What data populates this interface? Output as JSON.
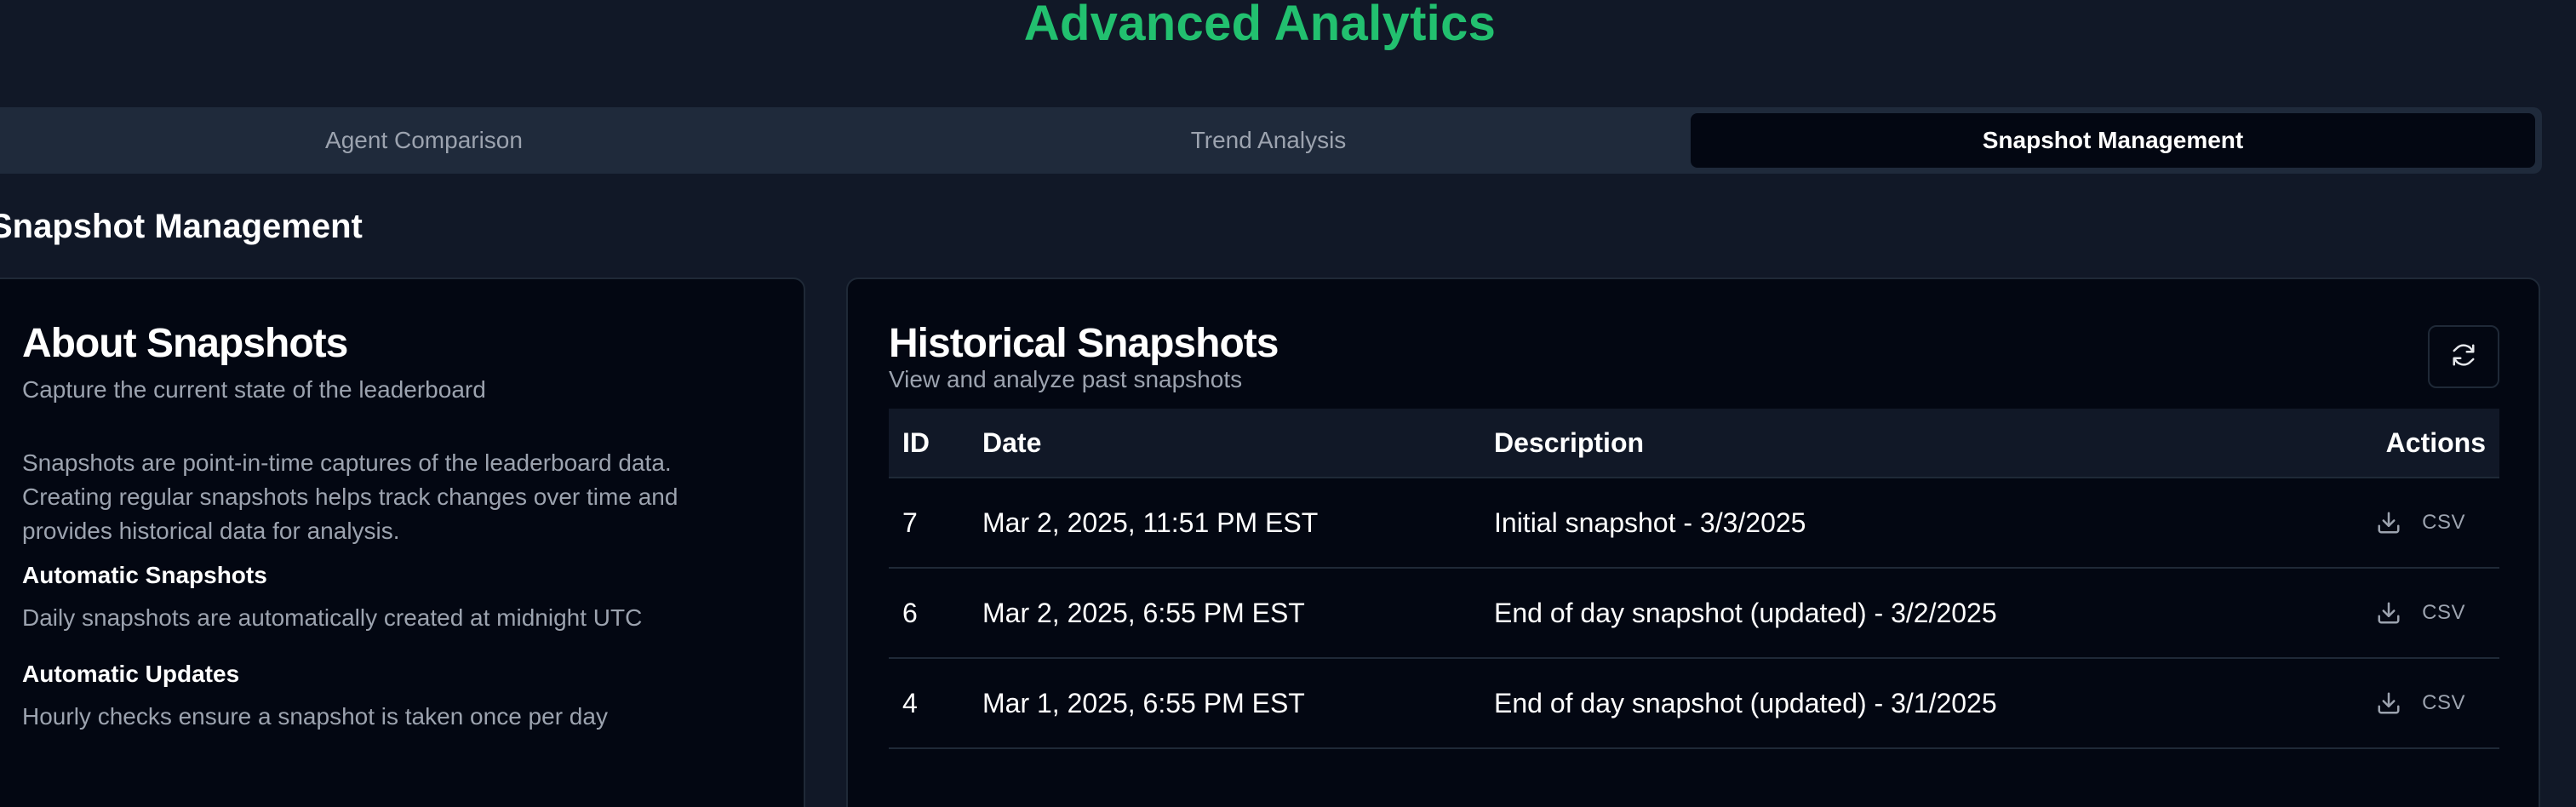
{
  "app": {
    "title": "Advanced Analytics"
  },
  "tabs": [
    {
      "label": "Agent Comparison",
      "active": false
    },
    {
      "label": "Trend Analysis",
      "active": false
    },
    {
      "label": "Snapshot Management",
      "active": true
    }
  ],
  "section": {
    "title": "Snapshot Management"
  },
  "about": {
    "title": "About Snapshots",
    "subtitle": "Capture the current state of the leaderboard",
    "body": "Snapshots are point-in-time captures of the leaderboard data. Creating regular snapshots helps track changes over time and provides historical data for analysis.",
    "items": [
      {
        "heading": "Automatic Snapshots",
        "text": "Daily snapshots are automatically created at midnight UTC"
      },
      {
        "heading": "Automatic Updates",
        "text": "Hourly checks ensure a snapshot is taken once per day"
      }
    ]
  },
  "history": {
    "title": "Historical Snapshots",
    "subtitle": "View and analyze past snapshots",
    "refresh_icon": "refresh-icon",
    "columns": {
      "id": "ID",
      "date": "Date",
      "description": "Description",
      "actions": "Actions"
    },
    "rows": [
      {
        "id": "7",
        "date": "Mar 2, 2025, 11:51 PM EST",
        "description": "Initial snapshot - 3/3/2025",
        "action_label": "CSV"
      },
      {
        "id": "6",
        "date": "Mar 2, 2025, 6:55 PM EST",
        "description": "End of day snapshot (updated) - 3/2/2025",
        "action_label": "CSV"
      },
      {
        "id": "4",
        "date": "Mar 1, 2025, 6:55 PM EST",
        "description": "End of day snapshot (updated) - 3/1/2025",
        "action_label": "CSV"
      }
    ]
  },
  "colors": {
    "accent": "#22c06f",
    "background": "#111827",
    "card": "#030712",
    "muted_text": "#9ca3af"
  }
}
